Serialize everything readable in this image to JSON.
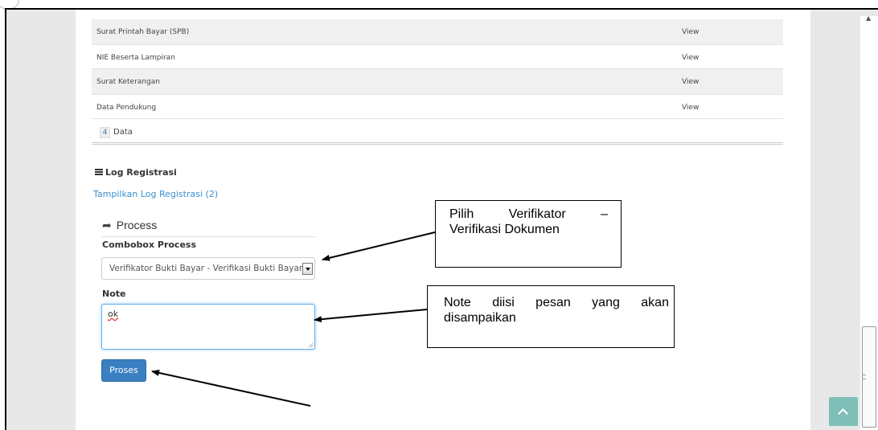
{
  "documents": {
    "rows": [
      {
        "name": "Surat Printah Bayar (SPB)",
        "action": "View"
      },
      {
        "name": "NIE Beserta Lampiran",
        "action": "View"
      },
      {
        "name": "Surat Keterangan",
        "action": "View"
      },
      {
        "name": "Data Pendukung",
        "action": "View"
      }
    ],
    "count": "4",
    "count_label": "Data"
  },
  "log": {
    "heading": "Log Registrasi",
    "link": "Tampilkan Log Registrasi (2)"
  },
  "process": {
    "title": "Process",
    "combo_label": "Combobox Process",
    "combo_value": "Verifikator Bukti Bayar - Verifikasi Bukti Bayar",
    "note_label": "Note",
    "note_value": "ok",
    "submit_label": "Proses"
  },
  "callouts": {
    "c1_w1": "Pilih",
    "c1_w2": "Verifikator",
    "c1_w3": "–",
    "c1_line2": "Verifikasi Dokumen",
    "c2_w1": "Note",
    "c2_w2": "diisi",
    "c2_w3": "pesan",
    "c2_w4": "yang",
    "c2_w5": "akan",
    "c2_line2": "disampaikan"
  },
  "colors": {
    "link": "#3a8fd0",
    "button": "#3a7fc1",
    "back_to_top": "#7fbfb8"
  },
  "icons": {
    "log": "list-icon",
    "process": "share-arrow-icon",
    "combo": "chevron-down-icon",
    "back_to_top": "chevron-up-icon"
  }
}
